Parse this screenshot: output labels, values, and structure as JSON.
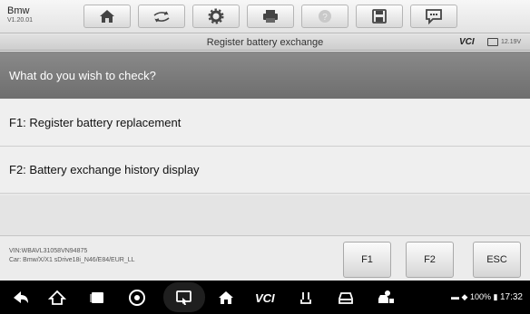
{
  "app": {
    "name": "Bmw",
    "version": "V1.20.01"
  },
  "toolbar": {
    "buttons": [
      {
        "icon": "home-icon"
      },
      {
        "icon": "vehicle-swap-icon"
      },
      {
        "icon": "settings-gear-icon"
      },
      {
        "icon": "print-icon"
      },
      {
        "icon": "help-icon"
      },
      {
        "icon": "save-icon"
      },
      {
        "icon": "data-logging-icon"
      }
    ]
  },
  "titlebar": {
    "title": "Register battery exchange",
    "vci": "VCI",
    "voltage": "12.19V"
  },
  "question": "What do you wish to check?",
  "functions": [
    {
      "label": "F1: Register battery replacement"
    },
    {
      "label": "F2: Battery exchange history display"
    }
  ],
  "vehicle": {
    "vin": "VIN:WBAVL31058VN94875",
    "car": "Car: Bmw/X/X1 sDrive18i_N46/E84/EUR_LL"
  },
  "footer_buttons": {
    "f1": "F1",
    "f2": "F2",
    "esc": "ESC"
  },
  "navbar": {
    "icons": [
      "back-icon",
      "home-icon",
      "recent-apps-icon",
      "chrome-icon",
      "screen-record-icon",
      "maxisys-home-icon",
      "vci-manager-icon",
      "power-icon",
      "car-icon",
      "remote-desk-icon"
    ],
    "status": {
      "battery": "100%",
      "time": "17:32"
    }
  },
  "colors": {
    "question_bg": "#7c7c7c",
    "list_bg": "#efefef",
    "navbar_bg": "#000000"
  }
}
